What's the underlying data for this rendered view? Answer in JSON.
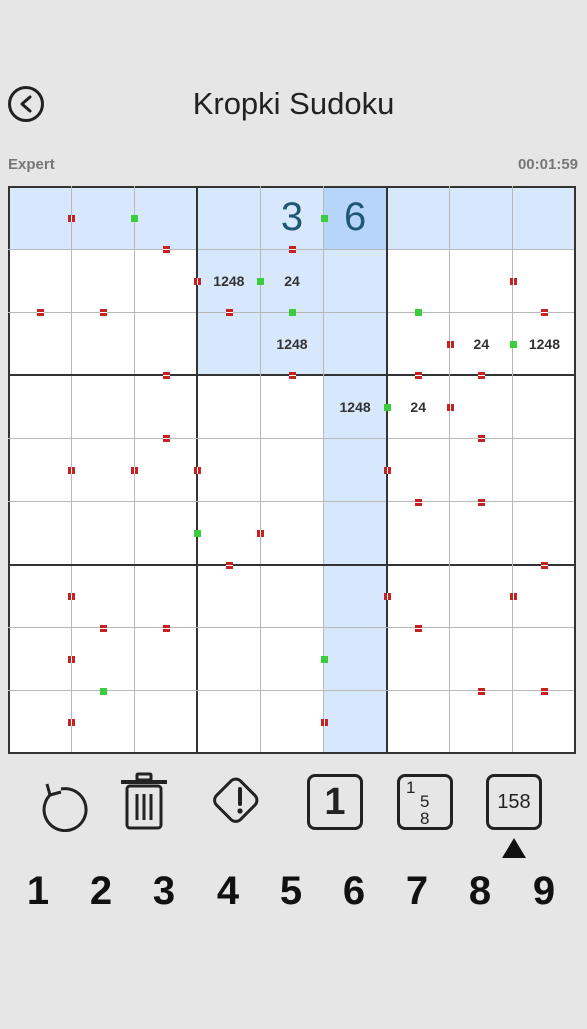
{
  "header": {
    "title": "Kropki Sudoku"
  },
  "status": {
    "difficulty": "Expert",
    "timer": "00:01:59"
  },
  "board": {
    "size": 9,
    "selected": [
      0,
      5
    ],
    "colors": {
      "highlight": "#d7e7fc",
      "selected": "#b7d5fb",
      "value": "#1e5873",
      "white_dot": "#c62222",
      "black_dot": "#3bcd3b"
    },
    "cells": [
      {
        "r": 0,
        "c": 4,
        "value": "3"
      },
      {
        "r": 0,
        "c": 5,
        "value": "6"
      },
      {
        "r": 1,
        "c": 3,
        "notes": "1248"
      },
      {
        "r": 1,
        "c": 4,
        "notes": "24"
      },
      {
        "r": 2,
        "c": 4,
        "notes": "1248"
      },
      {
        "r": 2,
        "c": 7,
        "notes": "24"
      },
      {
        "r": 2,
        "c": 8,
        "notes": "1248"
      },
      {
        "r": 3,
        "c": 5,
        "notes": "1248"
      },
      {
        "r": 3,
        "c": 6,
        "notes": "24"
      }
    ],
    "dots": [
      {
        "r": 0,
        "c": 0,
        "dir": "v",
        "color": "red"
      },
      {
        "r": 0,
        "c": 1,
        "dir": "v",
        "color": "green"
      },
      {
        "r": 0,
        "c": 4,
        "dir": "v",
        "color": "green"
      },
      {
        "r": 0,
        "c": 2,
        "dir": "h",
        "color": "red"
      },
      {
        "r": 0,
        "c": 4,
        "dir": "h",
        "color": "red"
      },
      {
        "r": 1,
        "c": 2,
        "dir": "v",
        "color": "red"
      },
      {
        "r": 1,
        "c": 3,
        "dir": "v",
        "color": "green"
      },
      {
        "r": 1,
        "c": 7,
        "dir": "v",
        "color": "red"
      },
      {
        "r": 1,
        "c": 0,
        "dir": "h",
        "color": "red"
      },
      {
        "r": 1,
        "c": 1,
        "dir": "h",
        "color": "red"
      },
      {
        "r": 1,
        "c": 3,
        "dir": "h",
        "color": "red"
      },
      {
        "r": 1,
        "c": 4,
        "dir": "h",
        "color": "green"
      },
      {
        "r": 1,
        "c": 6,
        "dir": "h",
        "color": "green"
      },
      {
        "r": 1,
        "c": 8,
        "dir": "h",
        "color": "red"
      },
      {
        "r": 2,
        "c": 6,
        "dir": "v",
        "color": "red"
      },
      {
        "r": 2,
        "c": 7,
        "dir": "v",
        "color": "green"
      },
      {
        "r": 2,
        "c": 2,
        "dir": "h",
        "color": "red"
      },
      {
        "r": 2,
        "c": 4,
        "dir": "h",
        "color": "red"
      },
      {
        "r": 2,
        "c": 6,
        "dir": "h",
        "color": "red"
      },
      {
        "r": 2,
        "c": 7,
        "dir": "h",
        "color": "red"
      },
      {
        "r": 3,
        "c": 5,
        "dir": "v",
        "color": "green"
      },
      {
        "r": 3,
        "c": 6,
        "dir": "v",
        "color": "red"
      },
      {
        "r": 3,
        "c": 2,
        "dir": "h",
        "color": "red"
      },
      {
        "r": 3,
        "c": 7,
        "dir": "h",
        "color": "red"
      },
      {
        "r": 4,
        "c": 0,
        "dir": "v",
        "color": "red"
      },
      {
        "r": 4,
        "c": 1,
        "dir": "v",
        "color": "red"
      },
      {
        "r": 4,
        "c": 2,
        "dir": "v",
        "color": "red"
      },
      {
        "r": 4,
        "c": 5,
        "dir": "v",
        "color": "red"
      },
      {
        "r": 4,
        "c": 6,
        "dir": "h",
        "color": "red"
      },
      {
        "r": 4,
        "c": 7,
        "dir": "h",
        "color": "red"
      },
      {
        "r": 5,
        "c": 2,
        "dir": "v",
        "color": "green"
      },
      {
        "r": 5,
        "c": 3,
        "dir": "v",
        "color": "red"
      },
      {
        "r": 5,
        "c": 3,
        "dir": "h",
        "color": "red"
      },
      {
        "r": 5,
        "c": 8,
        "dir": "h",
        "color": "red"
      },
      {
        "r": 6,
        "c": 0,
        "dir": "v",
        "color": "red"
      },
      {
        "r": 6,
        "c": 5,
        "dir": "v",
        "color": "red"
      },
      {
        "r": 6,
        "c": 7,
        "dir": "v",
        "color": "red"
      },
      {
        "r": 6,
        "c": 1,
        "dir": "h",
        "color": "red"
      },
      {
        "r": 6,
        "c": 2,
        "dir": "h",
        "color": "red"
      },
      {
        "r": 6,
        "c": 6,
        "dir": "h",
        "color": "red"
      },
      {
        "r": 7,
        "c": 0,
        "dir": "v",
        "color": "red"
      },
      {
        "r": 7,
        "c": 4,
        "dir": "v",
        "color": "green"
      },
      {
        "r": 7,
        "c": 1,
        "dir": "h",
        "color": "green"
      },
      {
        "r": 7,
        "c": 7,
        "dir": "h",
        "color": "red"
      },
      {
        "r": 7,
        "c": 8,
        "dir": "h",
        "color": "red"
      },
      {
        "r": 8,
        "c": 0,
        "dir": "v",
        "color": "red"
      },
      {
        "r": 8,
        "c": 4,
        "dir": "v",
        "color": "red"
      }
    ]
  },
  "toolbar": {
    "undo_icon": "undo-icon",
    "delete_icon": "trash-icon",
    "hint_icon": "alert-diamond-icon",
    "mode_single_label": "1",
    "mode_pencil_digits": [
      "1",
      "5",
      "8"
    ],
    "mode_notes_label": "158",
    "active_mode": "notes"
  },
  "numpad": [
    "1",
    "2",
    "3",
    "4",
    "5",
    "6",
    "7",
    "8",
    "9"
  ]
}
